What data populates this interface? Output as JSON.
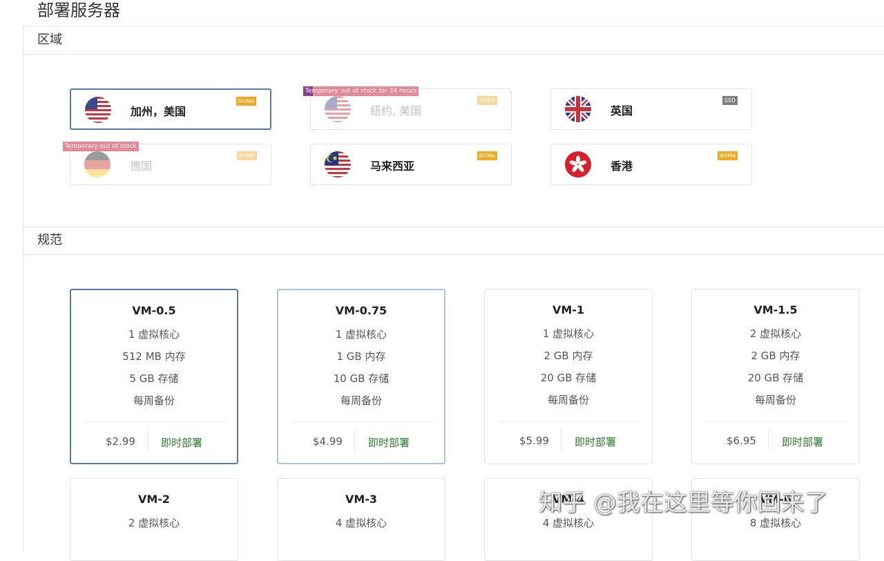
{
  "page": {
    "title": "部署服务器"
  },
  "sections": {
    "region_title": "区域",
    "spec_title": "规范"
  },
  "regions": [
    {
      "name": "加州，美国",
      "flag": "us-flag-icon",
      "tag": "NVMe",
      "selected": true
    },
    {
      "name": "纽约, 美国",
      "flag": "us-flag-icon",
      "tag": "NVMe",
      "stock": "Temporary out of stock for 24 hours"
    },
    {
      "name": "英国",
      "flag": "uk-flag-icon",
      "tag": "SSD"
    },
    {
      "name": "德国",
      "flag": "de-flag-icon",
      "tag": "NVMe",
      "stock": "Temporary out of stock"
    },
    {
      "name": "马来西亚",
      "flag": "my-flag-icon",
      "tag": "NVMe"
    },
    {
      "name": "香港",
      "flag": "hk-flag-icon",
      "tag": "NVMe"
    }
  ],
  "plans": [
    {
      "name": "VM-0.5",
      "cores": "1 虚拟核心",
      "ram": "512 MB 内存",
      "storage": "5 GB 存储",
      "backup": "每周备份",
      "price": "$2.99",
      "deploy": "即时部署"
    },
    {
      "name": "VM-0.75",
      "cores": "1 虚拟核心",
      "ram": "1 GB 内存",
      "storage": "10 GB 存储",
      "backup": "每周备份",
      "price": "$4.99",
      "deploy": "即时部署"
    },
    {
      "name": "VM-1",
      "cores": "1 虚拟核心",
      "ram": "2 GB 内存",
      "storage": "20 GB 存储",
      "backup": "每周备份",
      "price": "$5.99",
      "deploy": "即时部署"
    },
    {
      "name": "VM-1.5",
      "cores": "2 虚拟核心",
      "ram": "2 GB 内存",
      "storage": "20 GB 存储",
      "backup": "每周备份",
      "price": "$6.95",
      "deploy": "即时部署"
    },
    {
      "name": "VM-2",
      "cores": "2 虚拟核心"
    },
    {
      "name": "VM-3",
      "cores": "4 虚拟核心"
    },
    {
      "name": "VM-4",
      "cores": "4 虚拟核心"
    },
    {
      "name": "VM-6",
      "cores": "8 虚拟核心"
    }
  ],
  "watermark": "知乎 @我在这里等你回来了",
  "colors": {
    "selected_border": "#557ca8",
    "nvme_tag": "#f3a81d",
    "ssd_tag": "#7e7e7e",
    "deploy_text": "#2c7a2c",
    "stock_label": "#e88896"
  }
}
